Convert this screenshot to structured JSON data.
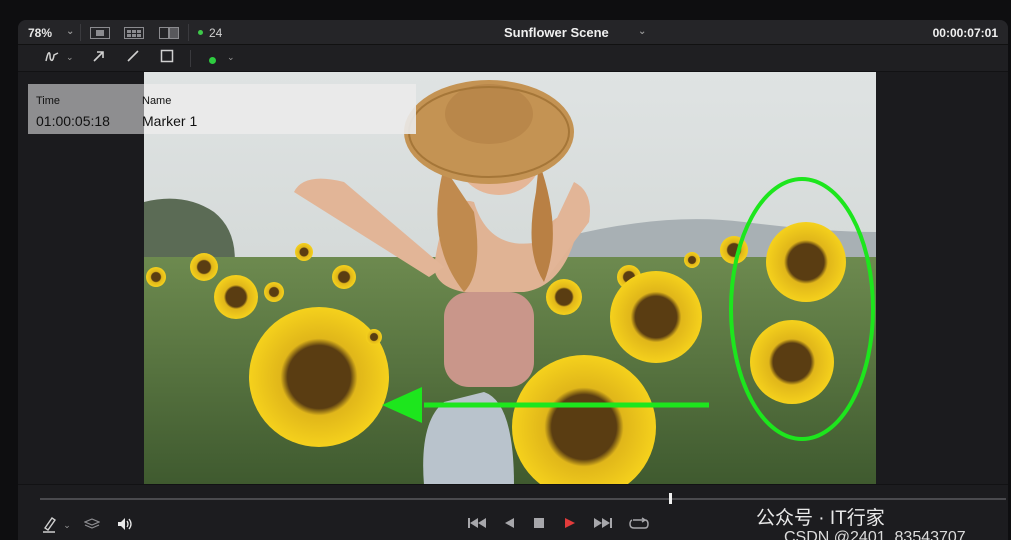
{
  "topbar": {
    "zoom": "78%",
    "fps": "24",
    "scene_title": "Sunflower Scene",
    "timecode": "00:00:07:01"
  },
  "toolbar": {
    "tools": [
      "freehand-pen-icon",
      "arrow-icon",
      "line-icon",
      "rectangle-icon"
    ],
    "annotation_color": "#2ecc40"
  },
  "marker": {
    "time_label": "Time",
    "time_value": "01:00:05:18",
    "name_label": "Name",
    "name_value": "Marker 1"
  },
  "annotation": {
    "color": "#1de61d",
    "shapes": [
      "ellipse",
      "arrow"
    ]
  },
  "transport": {
    "buttons": [
      "skip-back-icon",
      "play-reverse-icon",
      "stop-icon",
      "play-icon",
      "skip-forward-icon",
      "loop-icon"
    ],
    "play_color": "#e23b3b"
  },
  "watermark": {
    "line1": "公众号 · IT行家",
    "line2": "CSDN @2401_83543707"
  }
}
